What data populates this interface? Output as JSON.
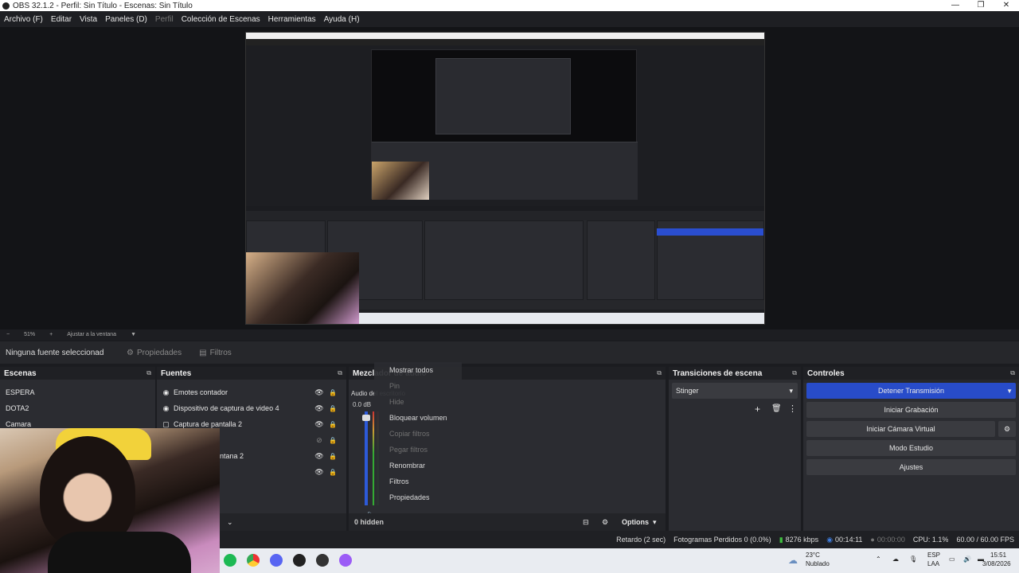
{
  "window": {
    "title": "OBS 32.1.2 - Perfil: Sin Título - Escenas: Sin Título"
  },
  "menu": [
    "Archivo (F)",
    "Editar",
    "Vista",
    "Paneles (D)",
    "Perfil",
    "Colección de Escenas",
    "Herramientas",
    "Ayuda (H)"
  ],
  "zoom": {
    "value": "51%",
    "fit": "Ajustar a la ventana"
  },
  "source_toolbar": {
    "none_selected": "Ninguna fuente seleccionad",
    "properties": "Propiedades",
    "filters": "Filtros"
  },
  "scenes": {
    "title": "Escenas",
    "items": [
      "ESPERA",
      "DOTA2",
      "Camara"
    ]
  },
  "sources": {
    "title": "Fuentes",
    "items": [
      {
        "label": "Emotes contador",
        "icon": "camera-icon"
      },
      {
        "label": "Dispositivo de captura de video 4",
        "icon": "camera-icon"
      },
      {
        "label": "Captura de pantalla 2",
        "icon": "monitor-icon"
      },
      {
        "label": "",
        "icon": ""
      },
      {
        "label": "ntana 2",
        "icon": ""
      },
      {
        "label": "",
        "icon": ""
      }
    ]
  },
  "mixer": {
    "title": "Mezclador de audio",
    "channel": "Audio del escritorio",
    "db": "0.0 dB",
    "hidden": "0 hidden",
    "options": "Options"
  },
  "context_menu": [
    {
      "label": "Mostrar todos",
      "disabled": false
    },
    {
      "label": "Pin",
      "disabled": true
    },
    {
      "label": "Hide",
      "disabled": true
    },
    {
      "label": "Bloquear volumen",
      "disabled": false
    },
    {
      "label": "Copiar filtros",
      "disabled": true
    },
    {
      "label": "Pegar filtros",
      "disabled": true
    },
    {
      "label": "Renombrar",
      "disabled": false
    },
    {
      "label": "Filtros",
      "disabled": false
    },
    {
      "label": "Propiedades",
      "disabled": false
    }
  ],
  "transitions": {
    "title": "Transiciones de escena",
    "selected": "Stinger"
  },
  "controls": {
    "title": "Controles",
    "stop_stream": "Detener Transmisión",
    "start_record": "Iniciar Grabación",
    "virtual_cam": "Iniciar Cámara Virtual",
    "studio": "Modo Estudio",
    "settings": "Ajustes"
  },
  "status": {
    "delay": "Retardo (2 sec)",
    "dropped": "Fotogramas Perdidos 0 (0.0%)",
    "bitrate": "8276 kbps",
    "live_time": "00:14:11",
    "rec_time": "00:00:00",
    "cpu": "CPU: 1.1%",
    "fps": "60.00 / 60.00 FPS"
  },
  "taskbar": {
    "temp": "23°C",
    "weather": "Nublado",
    "lang1": "ESP",
    "lang2": "LAA",
    "time": "15:51",
    "date": "3/08/2026"
  }
}
